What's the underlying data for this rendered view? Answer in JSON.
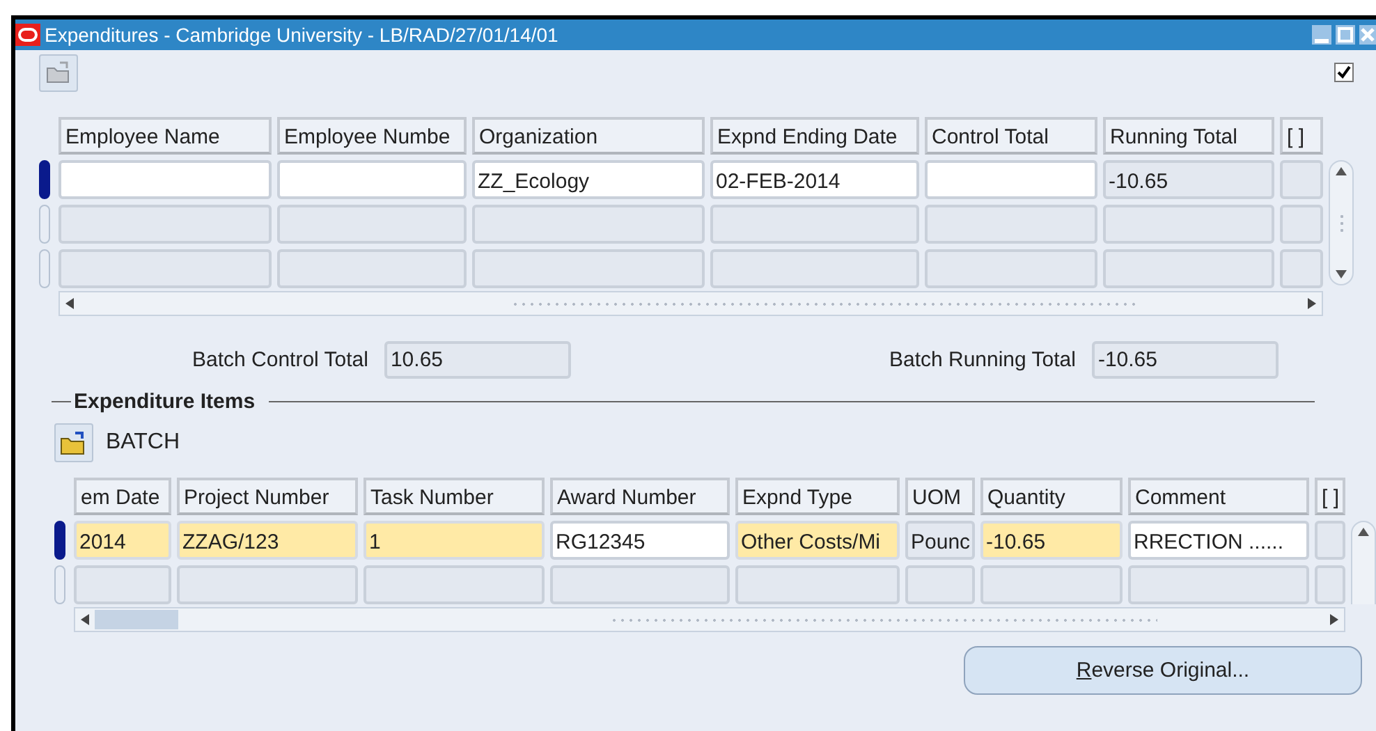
{
  "window": {
    "title": "Expenditures - Cambridge University - LB/RAD/27/01/14/01"
  },
  "toolbar": {
    "checkbox_checked": true
  },
  "header_table": {
    "columns": [
      "Employee Name",
      "Employee Numbe",
      "Organization",
      "Expnd Ending Date",
      "Control Total",
      "Running Total",
      "[ ]"
    ],
    "rows": [
      {
        "selected": true,
        "cells": [
          {
            "kind": "editable"
          },
          {
            "kind": "editable"
          },
          {
            "kind": "editable",
            "value": "ZZ_Ecology"
          },
          {
            "kind": "editable",
            "value": "02-FEB-2014"
          },
          {
            "kind": "editable"
          },
          {
            "kind": "readonly",
            "value": "-10.65"
          },
          {
            "kind": "readonly"
          }
        ]
      },
      {
        "selected": false,
        "cells": [
          {
            "kind": "readonly"
          },
          {
            "kind": "readonly"
          },
          {
            "kind": "readonly"
          },
          {
            "kind": "readonly"
          },
          {
            "kind": "readonly"
          },
          {
            "kind": "readonly"
          },
          {
            "kind": "readonly"
          }
        ]
      },
      {
        "selected": false,
        "cells": [
          {
            "kind": "readonly"
          },
          {
            "kind": "readonly"
          },
          {
            "kind": "readonly"
          },
          {
            "kind": "readonly"
          },
          {
            "kind": "readonly"
          },
          {
            "kind": "readonly"
          },
          {
            "kind": "readonly"
          }
        ]
      }
    ]
  },
  "batch_control_total": {
    "label": "Batch Control Total",
    "value": "10.65"
  },
  "batch_running_total": {
    "label": "Batch Running Total",
    "value": "-10.65"
  },
  "section": {
    "title": "Expenditure Items",
    "batch_label": "BATCH"
  },
  "items_table": {
    "columns": [
      "em Date",
      "Project Number",
      "Task Number",
      "Award Number",
      "Expnd Type",
      "UOM",
      "Quantity",
      "Comment",
      "[ ]"
    ],
    "rows": [
      {
        "selected": true,
        "cells": [
          {
            "kind": "required",
            "value": "2014"
          },
          {
            "kind": "required",
            "value": "ZZAG/123"
          },
          {
            "kind": "required",
            "value": "1"
          },
          {
            "kind": "editable",
            "value": "RG12345"
          },
          {
            "kind": "required",
            "value": "Other Costs/Mi"
          },
          {
            "kind": "readonly",
            "value": "Pounc"
          },
          {
            "kind": "required",
            "value": "-10.65"
          },
          {
            "kind": "editable",
            "value": "RRECTION ......"
          },
          {
            "kind": "readonly"
          }
        ]
      },
      {
        "selected": false,
        "cells": [
          {
            "kind": "readonly"
          },
          {
            "kind": "readonly"
          },
          {
            "kind": "readonly"
          },
          {
            "kind": "readonly"
          },
          {
            "kind": "readonly"
          },
          {
            "kind": "readonly"
          },
          {
            "kind": "readonly"
          },
          {
            "kind": "readonly"
          },
          {
            "kind": "readonly"
          }
        ]
      }
    ]
  },
  "button": {
    "label": "Reverse Original..."
  }
}
